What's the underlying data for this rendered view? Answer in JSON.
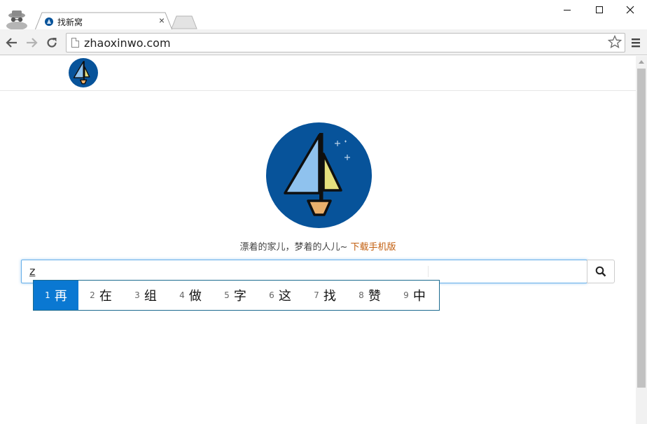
{
  "browser": {
    "tab": {
      "title": "找新窝",
      "close_glyph": "×"
    },
    "window_controls": {
      "minimize_icon": "minimize-icon",
      "maximize_icon": "maximize-icon",
      "close_icon": "close-icon"
    },
    "toolbar": {
      "url": "zhaoxinwo.com"
    }
  },
  "page": {
    "tagline": "漂着的家儿，梦着的人儿~",
    "download_link": "下载手机版",
    "search": {
      "typed_text": "z"
    },
    "ime": {
      "candidates": [
        {
          "num": "1",
          "char": "再"
        },
        {
          "num": "2",
          "char": "在"
        },
        {
          "num": "3",
          "char": "组"
        },
        {
          "num": "4",
          "char": "做"
        },
        {
          "num": "5",
          "char": "字"
        },
        {
          "num": "6",
          "char": "这"
        },
        {
          "num": "7",
          "char": "找"
        },
        {
          "num": "8",
          "char": "赞"
        },
        {
          "num": "9",
          "char": "中"
        }
      ],
      "active_index": 0
    }
  },
  "colors": {
    "logo_blue": "#07539a",
    "ime_active": "#0a78d2",
    "link_orange": "#c25e0e"
  }
}
